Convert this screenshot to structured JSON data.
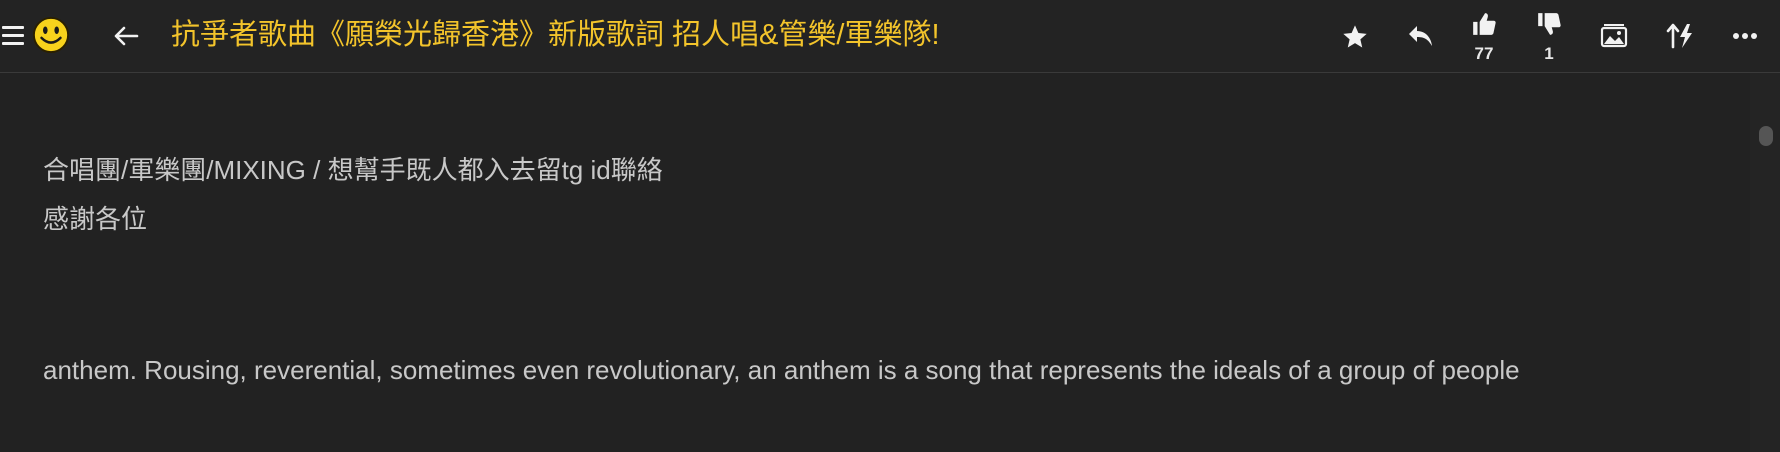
{
  "header": {
    "title": "抗爭者歌曲《願榮光歸香港》新版歌詞 招人唱&管樂/軍樂隊!",
    "like_count": "77",
    "dislike_count": "1"
  },
  "post": {
    "line1": "合唱團/軍樂團/MIXING / 想幫手既人都入去留tg id聯絡",
    "line2": "感謝各位",
    "line3": "anthem. Rousing, reverential, sometimes even revolutionary, an anthem is a song that represents the ideals of a group of people"
  },
  "colors": {
    "background": "#222222",
    "title": "#f3c42b",
    "text": "#c8c8c8"
  },
  "icons": [
    "menu-icon",
    "smiley-icon",
    "back-arrow-icon",
    "star-icon",
    "reply-icon",
    "thumbs-up-icon",
    "thumbs-down-icon",
    "image-icon",
    "sort-icon",
    "more-icon"
  ]
}
